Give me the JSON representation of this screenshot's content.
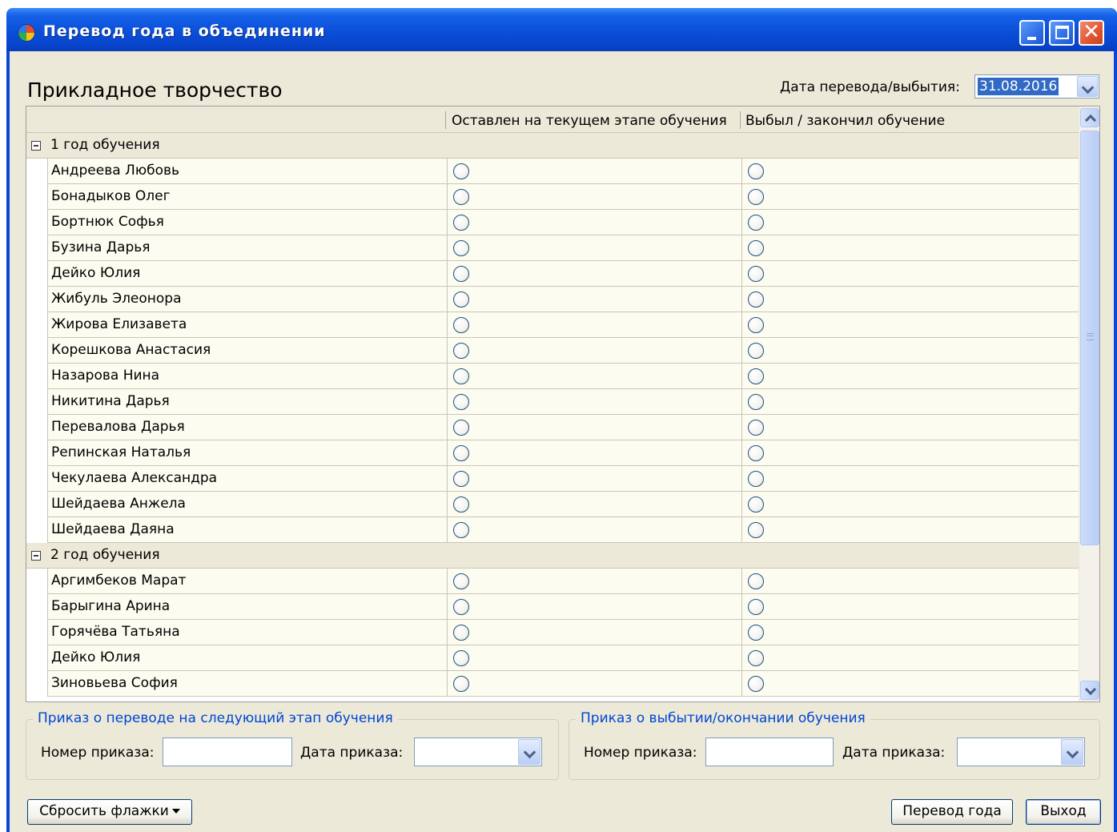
{
  "window": {
    "title": "Перевод года в объединении"
  },
  "header": {
    "title": "Прикладное творчество",
    "date_label": "Дата перевода/выбытия:",
    "date_value": "31.08.2016"
  },
  "grid": {
    "columns": [
      "Оставлен на текущем этапе обучения",
      "Выбыл / закончил обучение"
    ],
    "groups": [
      {
        "label": "1 год обучения",
        "students": [
          "Андреева Любовь",
          "Бонадыков Олег",
          "Бортнюк Софья",
          "Бузина Дарья",
          "Дейко Юлия",
          "Жибуль Элеонора",
          "Жирова Елизавета",
          "Корешкова Анастасия",
          "Назарова Нина",
          "Никитина Дарья",
          "Перевалова Дарья",
          "Репинская Наталья",
          "Чекулаева Александра",
          "Шейдаева Анжела",
          "Шейдаева Даяна"
        ]
      },
      {
        "label": "2 год обучения",
        "students": [
          "Аргимбеков Марат",
          "Барыгина Арина",
          "Горячёва Татьяна",
          "Дейко Юлия",
          "Зиновьева София"
        ]
      }
    ]
  },
  "transfer_order": {
    "legend": "Приказ о переводе на следующий этап обучения",
    "number_label": "Номер приказа:",
    "number_value": "",
    "date_label": "Дата приказа:",
    "date_value": ""
  },
  "dropout_order": {
    "legend": "Приказ о выбытии/окончании обучения",
    "number_label": "Номер приказа:",
    "number_value": "",
    "date_label": "Дата приказа:",
    "date_value": ""
  },
  "buttons": {
    "reset": "Сбросить флажки",
    "transfer": "Перевод года",
    "exit": "Выход"
  },
  "colors": {
    "title_bar": "#0a4fd8",
    "client_bg": "#ece9d8",
    "row_bg": "#fdfcf0",
    "legend_text": "#0046d5",
    "selection": "#316ac5"
  },
  "icons": [
    "app-icon",
    "minimize-icon",
    "maximize-icon",
    "close-icon",
    "collapse-icon",
    "chevron-down-icon",
    "scroll-up-icon",
    "scroll-down-icon"
  ]
}
